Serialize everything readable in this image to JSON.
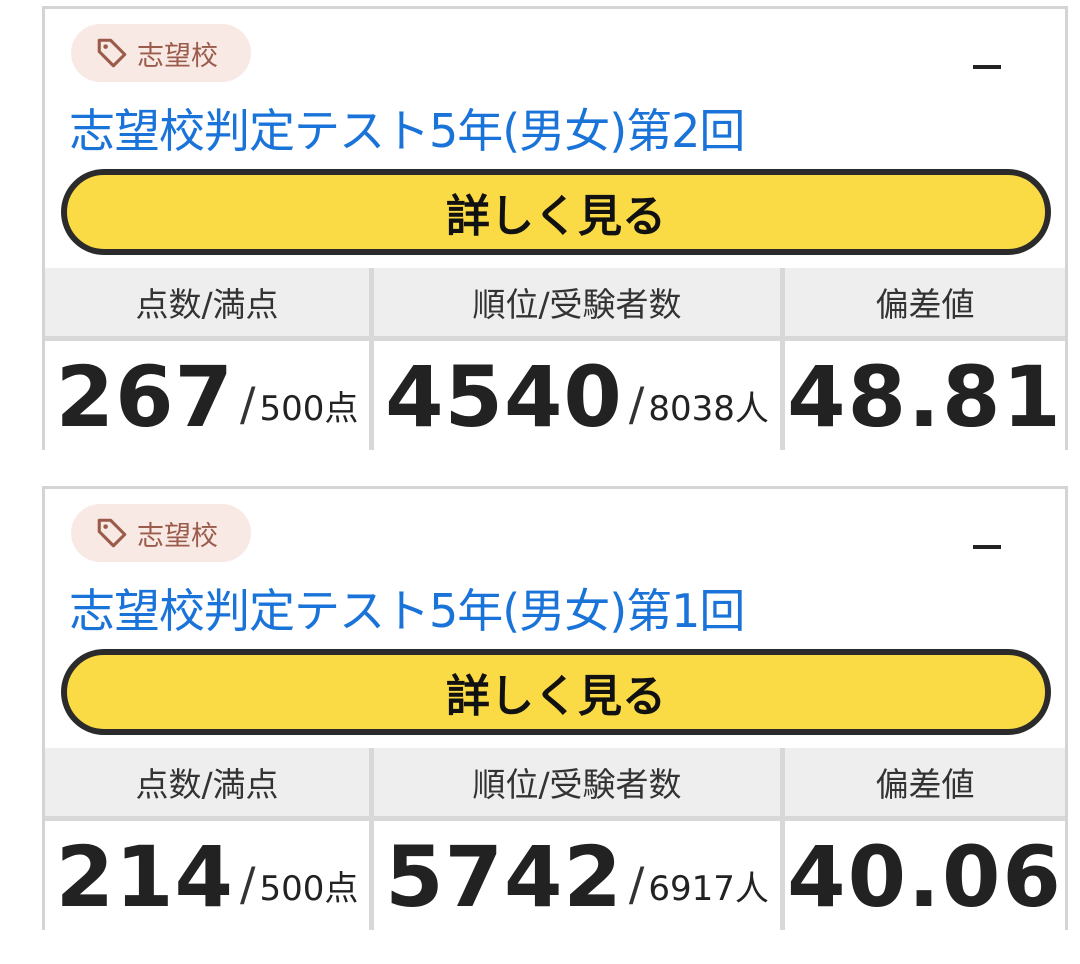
{
  "cards": [
    {
      "tag": "志望校",
      "title": "志望校判定テスト5年(男女)第2回",
      "collapse_symbol": "—",
      "button_label": "詳しく見る",
      "headers": [
        "点数/満点",
        "順位/受験者数",
        "偏差値"
      ],
      "score": "267",
      "score_max": "500点",
      "rank": "4540",
      "examinees": "8038人",
      "deviation": "48.81"
    },
    {
      "tag": "志望校",
      "title": "志望校判定テスト5年(男女)第1回",
      "collapse_symbol": "—",
      "button_label": "詳しく見る",
      "headers": [
        "点数/満点",
        "順位/受験者数",
        "偏差値"
      ],
      "score": "214",
      "score_max": "500点",
      "rank": "5742",
      "examinees": "6917人",
      "deviation": "40.06"
    }
  ],
  "colors": {
    "title": "#1a73d9",
    "button_bg": "#fadb45",
    "badge_bg": "#f9e9e5",
    "badge_text": "#9a5b4a"
  },
  "icons": {
    "tag": "tag-icon"
  }
}
